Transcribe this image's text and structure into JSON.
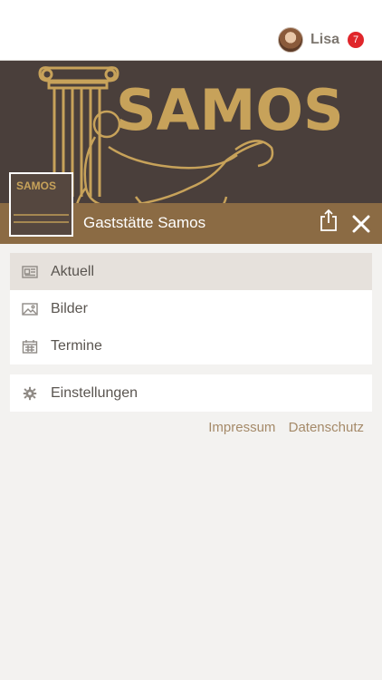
{
  "header": {
    "user_name": "Lisa",
    "notification_count": "7"
  },
  "hero": {
    "logo_text": "SAMOS",
    "venue_name": "Gaststätte Samos"
  },
  "menu_main": {
    "items": [
      {
        "label": "Aktuell",
        "icon": "newspaper-icon",
        "active": true
      },
      {
        "label": "Bilder",
        "icon": "image-icon",
        "active": false
      },
      {
        "label": "Termine",
        "icon": "calendar-icon",
        "active": false
      }
    ]
  },
  "menu_settings": {
    "items": [
      {
        "label": "Einstellungen",
        "icon": "gear-icon"
      }
    ]
  },
  "footer": {
    "impressum": "Impressum",
    "datenschutz": "Datenschutz"
  },
  "colors": {
    "accent": "#8b6b44",
    "logo_gold": "#c7a25a",
    "badge": "#e0262b",
    "active_row": "#e6e1dc"
  }
}
